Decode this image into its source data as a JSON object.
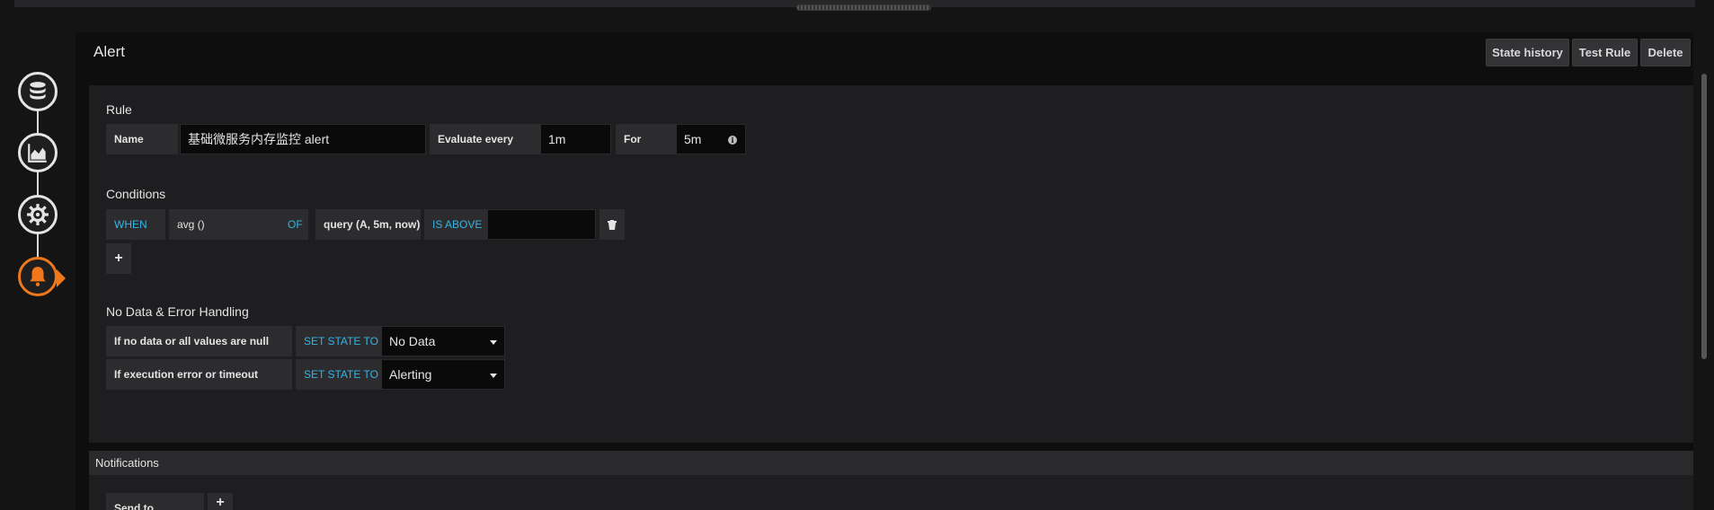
{
  "panel": {
    "title": "Alert",
    "buttons": {
      "state_history": "State history",
      "test_rule": "Test Rule",
      "delete": "Delete"
    }
  },
  "nav": {
    "items": [
      {
        "icon": "database-icon"
      },
      {
        "icon": "area-chart-icon"
      },
      {
        "icon": "gear-icon"
      },
      {
        "icon": "bell-icon",
        "active": true
      }
    ],
    "active_color": "#f0781a"
  },
  "rule": {
    "heading": "Rule",
    "name_label": "Name",
    "name_value": "基础微服务内存监控 alert",
    "evaluate_label": "Evaluate every",
    "evaluate_value": "1m",
    "for_label": "For",
    "for_value": "5m"
  },
  "conditions": {
    "heading": "Conditions",
    "when": "WHEN",
    "reducer": "avg ()",
    "of": "OF",
    "query": "query (A, 5m, now)",
    "evaluator": "IS ABOVE",
    "threshold": "",
    "add": "+"
  },
  "nodata": {
    "heading": "No Data & Error Handling",
    "rows": [
      {
        "label": "If no data or all values are null",
        "action": "SET STATE TO",
        "value": "No Data"
      },
      {
        "label": "If execution error or timeout",
        "action": "SET STATE TO",
        "value": "Alerting"
      }
    ]
  },
  "notifications": {
    "heading": "Notifications",
    "send_to_label": "Send to",
    "add": "+"
  },
  "colors": {
    "keyword": "#33b5e5",
    "background": "#141414"
  }
}
